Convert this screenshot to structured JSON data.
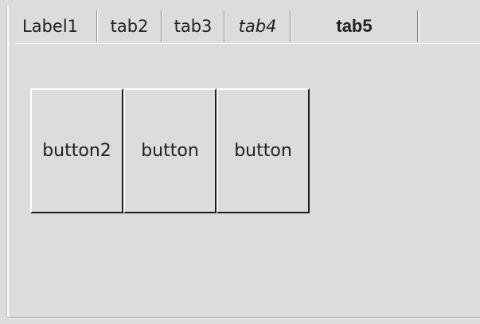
{
  "tabs": [
    {
      "label": "Label1"
    },
    {
      "label": "tab2"
    },
    {
      "label": "tab3"
    },
    {
      "label": "tab4"
    },
    {
      "label": "tab5"
    }
  ],
  "buttons": [
    {
      "label": "button2"
    },
    {
      "label": "button"
    },
    {
      "label": "button"
    }
  ]
}
